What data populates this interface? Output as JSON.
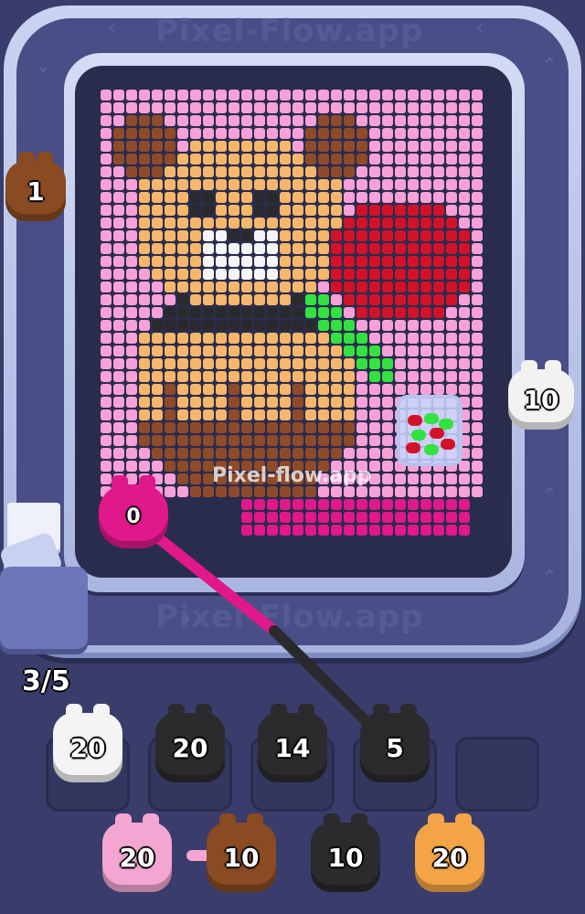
{
  "watermark": {
    "text": "Pixel-Flow.app",
    "overlay_text": "Pixel-flow.app"
  },
  "queue": {
    "progress_text": "3/5"
  },
  "belt_pigs": [
    {
      "count": "1",
      "color": "#8a4a22"
    },
    {
      "count": "10",
      "color": "#f2f2f2"
    },
    {
      "count": "0",
      "color": "#e0188a"
    }
  ],
  "holding_slots": [
    {
      "count": "20",
      "color": "#f4f4f4"
    },
    {
      "count": "20",
      "color": "#2b2b2e"
    },
    {
      "count": "14",
      "color": "#2b2b2e"
    },
    {
      "count": "5",
      "color": "#2b2b2e"
    },
    {
      "count": "",
      "color": ""
    }
  ],
  "waiting_pigs": [
    {
      "count": "20",
      "color": "#f4a6d2"
    },
    {
      "count": "10",
      "color": "#8a4a22"
    },
    {
      "count": "10",
      "color": "#2b2b2e"
    },
    {
      "count": "20",
      "color": "#f2a447"
    }
  ],
  "colors": {
    "pink": "#f7a1d8",
    "magenta": "#e0188a",
    "tan": "#f6b76a",
    "brown": "#8e4b2a",
    "black": "#2a2a2e",
    "white": "#f5f5f5",
    "red": "#d3122a",
    "green": "#33e23f"
  }
}
